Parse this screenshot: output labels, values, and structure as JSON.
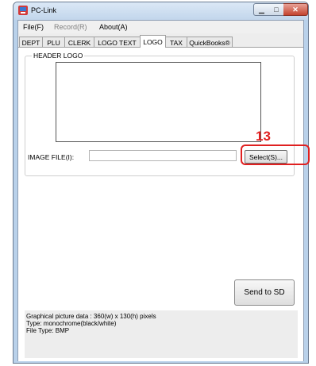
{
  "window": {
    "title": "PC-Link"
  },
  "menu": [
    {
      "label": "File(F)"
    },
    {
      "label": "Record(R)"
    },
    {
      "label": "About(A)"
    }
  ],
  "tabs": [
    {
      "label": "DEPT"
    },
    {
      "label": "PLU"
    },
    {
      "label": "CLERK"
    },
    {
      "label": "LOGO TEXT"
    },
    {
      "label": "LOGO"
    },
    {
      "label": "TAX"
    },
    {
      "label": "QuickBooks®"
    }
  ],
  "active_tab": "LOGO",
  "header_group": {
    "label": "HEADER LOGO"
  },
  "image_file": {
    "label": "IMAGE FILE(I):",
    "value": ""
  },
  "buttons": {
    "select": "Select(S)...",
    "send": "Send to SD"
  },
  "annotation": {
    "number": "13",
    "color": "#e02020"
  },
  "info": {
    "line1": "Graphical picture data : 360(w) x 130(h) pixels",
    "line2": "Type: monochrome(black/white)",
    "line3": "File Type: BMP"
  }
}
